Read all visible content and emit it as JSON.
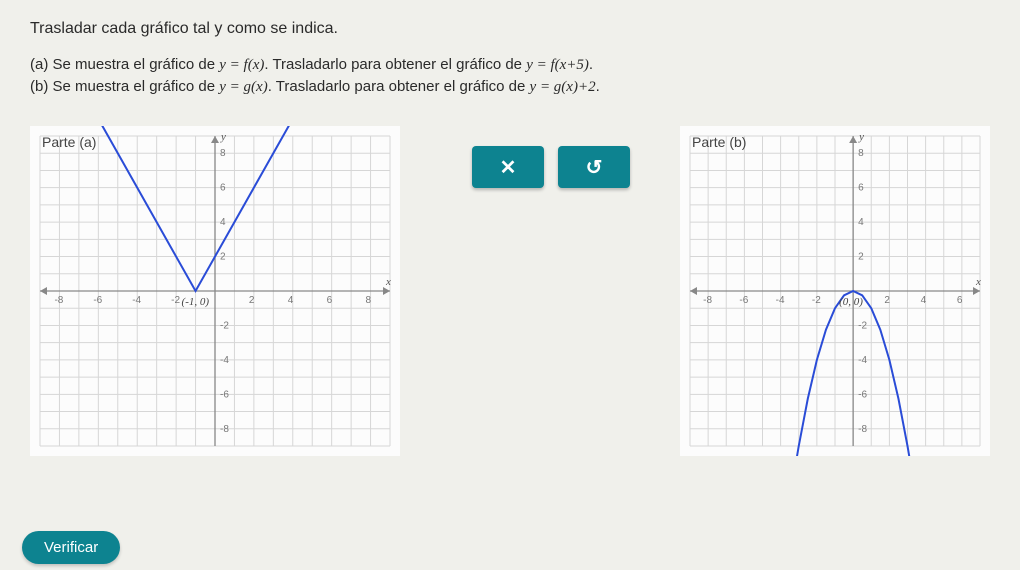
{
  "instruction": "Trasladar cada gráfico tal y como se indica.",
  "part_a_text": "(a) Se muestra el gráfico de y = f(x). Trasladarlo para obtener el gráfico de y = f(x+5).",
  "part_b_text": "(b) Se muestra el gráfico de y = g(x). Trasladarlo para obtener el gráfico de y = g(x)+2.",
  "buttons": {
    "close": "✕",
    "undo": "↺"
  },
  "verify": "Verificar",
  "chart_data": [
    {
      "type": "line",
      "label": "Parte (a)",
      "xlabel": "x",
      "ylabel": "y",
      "xlim": [
        -9,
        9
      ],
      "ylim": [
        -9,
        9
      ],
      "xticks": [
        -8,
        -6,
        -4,
        -2,
        2,
        4,
        6,
        8
      ],
      "yticks": [
        -8,
        -6,
        -4,
        -2,
        2,
        4,
        6,
        8
      ],
      "vertex_label": "(-1, 0)",
      "series": [
        {
          "name": "f(x)",
          "x": [
            -6,
            -1,
            4
          ],
          "y": [
            10,
            0,
            10
          ]
        }
      ]
    },
    {
      "type": "line",
      "label": "Parte (b)",
      "xlabel": "x",
      "ylabel": "y",
      "xlim": [
        -9,
        7
      ],
      "ylim": [
        -9,
        9
      ],
      "xticks": [
        -8,
        -6,
        -4,
        -2,
        2,
        4,
        6
      ],
      "yticks": [
        -8,
        -6,
        -4,
        -2,
        2,
        4,
        6,
        8
      ],
      "vertex_label": "(0, 0)",
      "series": [
        {
          "name": "g(x)",
          "x": [
            -3.2,
            -3,
            -2.5,
            -2,
            -1.5,
            -1,
            -0.5,
            0,
            0.5,
            1,
            1.5,
            2,
            2.5,
            3,
            3.2
          ],
          "y": [
            -10.24,
            -9,
            -6.25,
            -4,
            -2.25,
            -1,
            -0.25,
            0,
            -0.25,
            -1,
            -2.25,
            -4,
            -6.25,
            -9,
            -10.24
          ]
        }
      ]
    }
  ]
}
